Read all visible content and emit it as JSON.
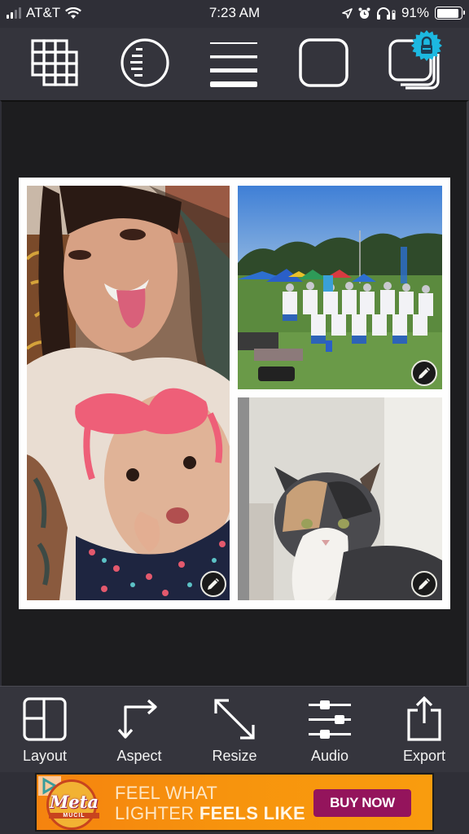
{
  "status_bar": {
    "carrier": "AT&T",
    "time": "7:23 AM",
    "battery_percent": "91%",
    "battery_level": 0.91,
    "signal_bars_active": 2,
    "signal_bars_total": 4,
    "icons": [
      "signal-icon",
      "wifi-icon",
      "location-icon",
      "alarm-icon",
      "headphones-icon",
      "battery-icon"
    ]
  },
  "top_toolbar": {
    "tools": [
      {
        "name": "grid-tool",
        "icon": "grid-icon",
        "locked": false
      },
      {
        "name": "corner-radius-tool",
        "icon": "half-circle-lines-icon",
        "locked": false
      },
      {
        "name": "border-width-tool",
        "icon": "line-thickness-icon",
        "locked": false
      },
      {
        "name": "rounded-corners-tool",
        "icon": "rounded-square-icon",
        "locked": false
      },
      {
        "name": "shadow-tool",
        "icon": "shadow-square-icon",
        "locked": true
      }
    ],
    "lock_color": "#1cb8e0"
  },
  "collage": {
    "frame_color": "#ffffff",
    "cells": [
      {
        "description": "Selfie of woman with tongue out holding baby with pink headband",
        "editable": true
      },
      {
        "description": "Youth lacrosse team group photo on grass field with canopies",
        "editable": true
      },
      {
        "description": "Calico cat sitting near window",
        "editable": true
      }
    ]
  },
  "bottom_toolbar": {
    "items": [
      {
        "label": "Layout",
        "icon": "layout-icon"
      },
      {
        "label": "Aspect",
        "icon": "aspect-arrows-icon"
      },
      {
        "label": "Resize",
        "icon": "resize-diagonal-icon"
      },
      {
        "label": "Audio",
        "icon": "sliders-icon"
      },
      {
        "label": "Export",
        "icon": "share-icon"
      }
    ]
  },
  "ad": {
    "brand": "Meta",
    "brand_sub": "MUCIL",
    "headline_line1": "FEEL WHAT",
    "headline_line2_light": "LIGHTER ",
    "headline_line2_bold": "FEELS LIKE",
    "cta": "BUY NOW",
    "cta_color": "#94145c",
    "bg_color": "#f7900e"
  }
}
